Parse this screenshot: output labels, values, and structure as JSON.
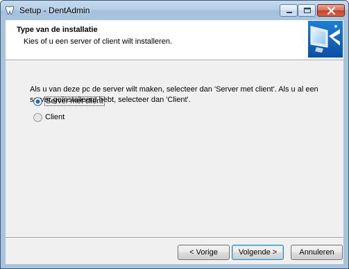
{
  "window": {
    "title": "Setup - DentAdmin"
  },
  "header": {
    "title": "Type van de installatie",
    "subtitle": "Kies of u een server of client wilt installeren."
  },
  "main": {
    "description": "Als u van deze pc de server wilt maken, selecteer dan 'Server met client'. Als u al een server geïnstalleerd hebt, selecteer dan 'Client'.",
    "options": [
      {
        "label": "Server met client",
        "selected": true
      },
      {
        "label": "Client",
        "selected": false
      }
    ]
  },
  "buttons": {
    "back": "< Vorige",
    "next": "Volgende >",
    "cancel": "Annuleren"
  }
}
